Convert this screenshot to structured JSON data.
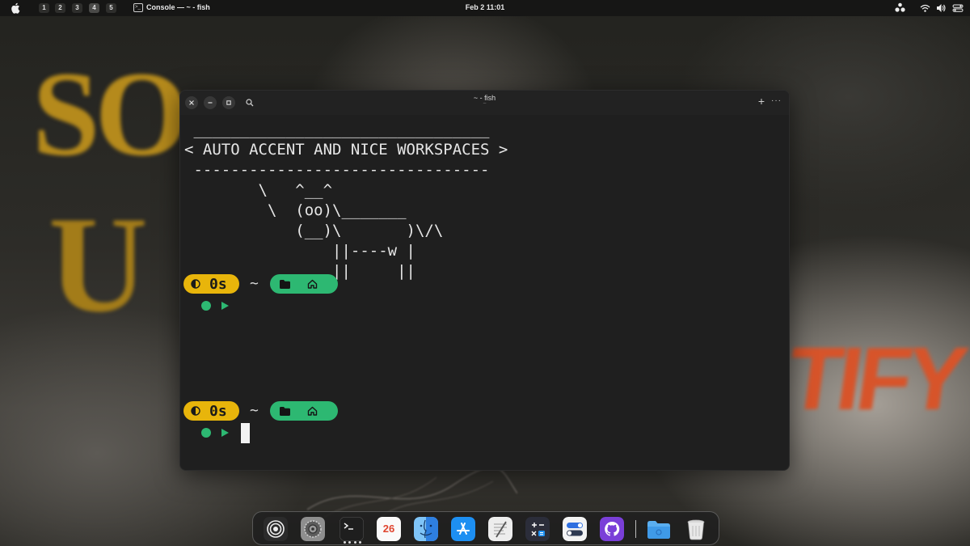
{
  "topbar": {
    "workspaces": [
      "1",
      "2",
      "3",
      "4",
      "5"
    ],
    "active_workspace": "4",
    "app_name": "Console",
    "separator": "—",
    "window_title": "~ - fish",
    "clock": "Feb 2  11:01"
  },
  "window": {
    "title": "~ - fish",
    "subtitle": "~"
  },
  "terminal": {
    "cowsay": " ________________________________\n< AUTO ACCENT AND NICE WORKSPACES >\n --------------------------------\n        \\   ^__^\n         \\  (oo)\\_______\n            (__)\\       )\\/\\\n                ||----w |\n                ||     ||",
    "prompt_duration": "0s",
    "prompt_dir": "~"
  },
  "dock": {
    "calendar_day": "26",
    "items": [
      "launcher-icon",
      "settings-icon",
      "terminal-icon",
      "calendar-icon",
      "finder-icon",
      "app-store-icon",
      "text-editor-icon",
      "calculator-icon",
      "toggle-settings-icon",
      "github-icon",
      "files-folder-icon",
      "trash-icon"
    ]
  },
  "colors": {
    "accent_yellow": "#e8b50b",
    "accent_green": "#2db872",
    "terminal_bg": "#1f1f1f"
  }
}
